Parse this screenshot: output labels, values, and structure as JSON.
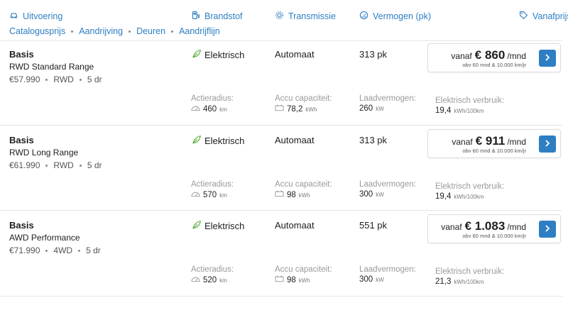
{
  "columns": {
    "uitvoering": "Uitvoering",
    "brandstof": "Brandstof",
    "transmissie": "Transmissie",
    "vermogen": "Vermogen (pk)",
    "vanafprijs": "Vanafprijs"
  },
  "sort_links": [
    "Catalogusprijs",
    "Aandrijving",
    "Deuren",
    "Aandrijflijn"
  ],
  "labels": {
    "range": "Actieradius:",
    "battery": "Accu capaciteit:",
    "charging": "Laadvermogen:",
    "consumption": "Elektrisch verbruik:",
    "unit_km": "km",
    "unit_kwh": "kWh",
    "unit_kw": "kW",
    "unit_kwh100": "kWh/100km",
    "price_pre": "vanaf",
    "price_post": "/mnd",
    "price_note": "obv 60 mnd & 10.000 km/jr"
  },
  "rows": [
    {
      "name": "Basis",
      "variant": "RWD Standard Range",
      "catalog_price": "€57.990",
      "drive": "RWD",
      "doors": "5 dr",
      "fuel": "Elektrisch",
      "transmission": "Automaat",
      "power": "313 pk",
      "monthly": "€ 860",
      "range": "460",
      "battery": "78,2",
      "charging": "260",
      "consumption": "19,4"
    },
    {
      "name": "Basis",
      "variant": "RWD Long Range",
      "catalog_price": "€61.990",
      "drive": "RWD",
      "doors": "5 dr",
      "fuel": "Elektrisch",
      "transmission": "Automaat",
      "power": "313 pk",
      "monthly": "€ 911",
      "range": "570",
      "battery": "98",
      "charging": "300",
      "consumption": "19,4"
    },
    {
      "name": "Basis",
      "variant": "AWD Performance",
      "catalog_price": "€71.990",
      "drive": "4WD",
      "doors": "5 dr",
      "fuel": "Elektrisch",
      "transmission": "Automaat",
      "power": "551 pk",
      "monthly": "€ 1.083",
      "range": "520",
      "battery": "98",
      "charging": "300",
      "consumption": "21,3"
    }
  ],
  "colors": {
    "accent": "#2e7ec3",
    "leaf": "#5aab3c",
    "muted": "#9a9a9a"
  },
  "icons": {
    "uitvoering": "car-icon",
    "brandstof": "fuel-pump-icon",
    "transmissie": "gear-icon",
    "vermogen": "speedometer-icon",
    "vanafprijs": "price-tag-icon",
    "fuel": "leaf-icon",
    "range": "gauge-icon",
    "battery": "battery-icon",
    "button": "chevron-right-icon"
  }
}
